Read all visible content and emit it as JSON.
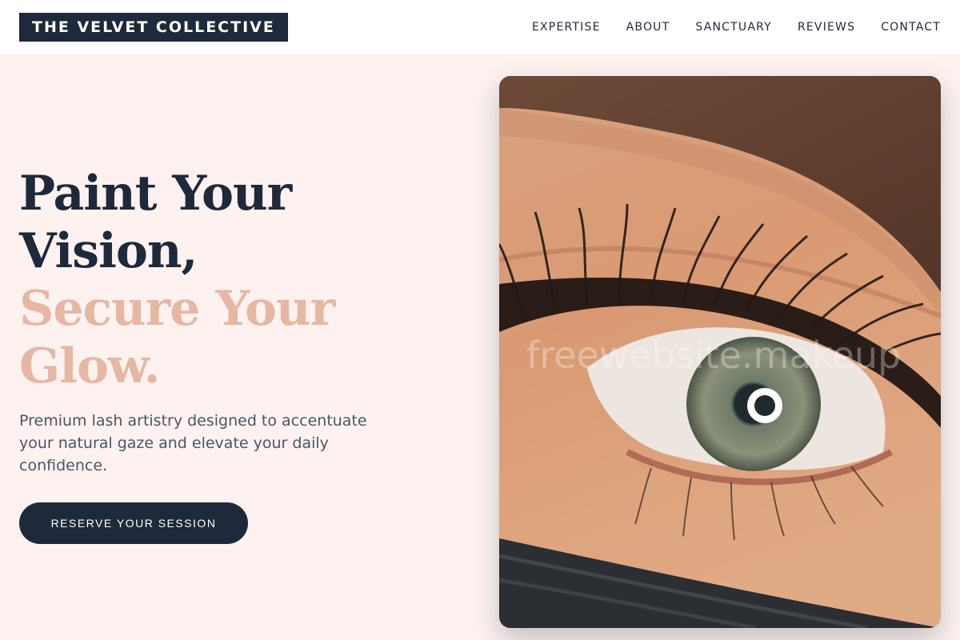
{
  "brand": {
    "name": "THE VELVET COLLECTIVE"
  },
  "nav": {
    "items": [
      "EXPERTISE",
      "ABOUT",
      "SANCTUARY",
      "REVIEWS",
      "CONTACT"
    ]
  },
  "hero": {
    "title_line1": "Paint Your",
    "title_line2": "Vision,",
    "title_line3": "Secure Your",
    "title_line4": "Glow.",
    "subtitle": "Premium lash artistry designed to accentuate your natural gaze and elevate your daily confidence.",
    "cta_label": "RESERVE YOUR SESSION"
  },
  "image": {
    "subject": "eye-with-lash-extensions",
    "watermark": "freewebsite.makeup"
  },
  "colors": {
    "background": "#fdf2f0",
    "navy": "#1e293b",
    "accent": "#e6b7a3",
    "body_text": "#4b5563"
  }
}
